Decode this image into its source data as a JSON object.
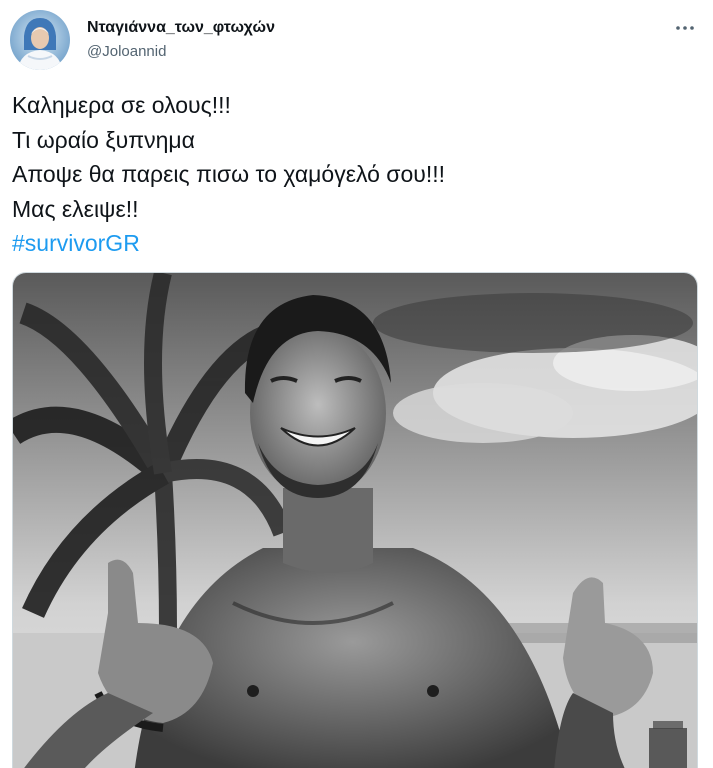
{
  "user": {
    "display_name": "Νταγιάννα_των_φτωχών",
    "handle": "@Joloannid",
    "avatar_icon": "profile-photo"
  },
  "header": {
    "more_icon": "more-dots-icon"
  },
  "tweet": {
    "lines": [
      "Καλημερα σε ολους!!!",
      "Τι ωραίο ξυπνημα",
      "Αποψε θα παρεις πισω το χαμόγελό σου!!!",
      "Μας ελειψε!!"
    ],
    "hashtag": "#survivorGR"
  },
  "media": {
    "type": "photo",
    "style": "black-and-white",
    "subject": "smiling shirtless man giving thumbs up on a beach with palm tree"
  },
  "colors": {
    "text": "#0f1419",
    "secondary": "#536471",
    "link": "#1d9bf0",
    "border": "#cfd9de"
  }
}
